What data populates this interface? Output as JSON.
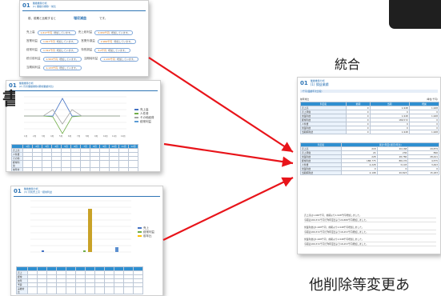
{
  "labels": {
    "merge": "統合",
    "bottom_note": "他削除等変更あ",
    "partial_glyph": "書"
  },
  "doc1": {
    "page_num": "01",
    "title_line1": "業績推移分析",
    "title_line2": "(1) 業績の推移・前比",
    "headline_prefix": "前、前期と比較すると",
    "headline_highlight": "増収減益",
    "headline_suffix": "です。",
    "rows": [
      {
        "label": "売上高",
        "v1": "1,617千円",
        "t1": "増加しています。",
        "label2": "売上総利益",
        "v2": "3,950千円",
        "t2": "増加しています。"
      },
      {
        "label": "営業利益",
        "v1": "1,617千円",
        "t1": "増加しています。",
        "label2": "営業外損益",
        "v2": "2,964千円",
        "t2": "増加しています。"
      },
      {
        "label": "経常利益",
        "v1": "1,312千円",
        "t1": "増加しています。",
        "label2": "特別損益",
        "v2": "3,2千円",
        "t2": "増加しています。"
      },
      {
        "label": "税引前利益",
        "v1": "1,504千円",
        "t1": "増加しています。",
        "label2": "当期純利益",
        "v2": "1,133千円",
        "t2": "増加しています。"
      },
      {
        "label": "当期純利益",
        "v1": "1,133千円",
        "t1": "増加しています。",
        "label2": "",
        "v2": "",
        "t2": ""
      }
    ]
  },
  "doc2": {
    "page_num": "01",
    "title_line1": "業績推移分析",
    "title_line2": "(2) 月次業績推移(期前業績対比)",
    "legend": [
      {
        "name": "売上高",
        "color": "#4472c4"
      },
      {
        "name": "人件費",
        "color": "#70ad47"
      },
      {
        "name": "その他経費",
        "color": "#a5a5a5"
      },
      {
        "name": "経常利益",
        "color": "#5b9bd5"
      }
    ],
    "months": [
      "1月",
      "2月",
      "3月",
      "4月",
      "5月",
      "6月",
      "7月",
      "8月",
      "9月",
      "10月",
      "11月",
      "12月"
    ],
    "row_labels": [
      "売上高",
      "人件費",
      "その他",
      "経常利益",
      "前年対比",
      "累計"
    ]
  },
  "doc3": {
    "page_num": "01",
    "title_line1": "業績推移分析",
    "title_line2": "(3) 月別売上高・経常利益",
    "legend": [
      {
        "name": "売上",
        "color": "#4472c4"
      },
      {
        "name": "経常利益",
        "color": "#70ad47"
      },
      {
        "name": "前年比",
        "color": "#ffc000"
      }
    ],
    "row_labels": [
      "売上",
      "経常",
      "前年",
      "予算",
      "実績対比"
    ]
  },
  "doc4": {
    "page_num": "01",
    "title_line1": "業績推移分析",
    "title_line2": "(1) 損益業績",
    "subtitle": "(千円/業績年次比較)",
    "table1_title": "前年対比",
    "table1_unit": "(単位:千円)",
    "table1_cols": [
      "科目名",
      "前期",
      "当期",
      "増減"
    ],
    "table1_rows": [
      {
        "name": "売上高",
        "a": "0",
        "b": "1,948",
        "c": "1,948"
      },
      {
        "name": "売上原価",
        "a": "0",
        "b": "0",
        "c": "0"
      },
      {
        "name": "営業利益",
        "a": "0",
        "b": "1,948",
        "c": "1,948"
      },
      {
        "name": "経常利益",
        "a": "0",
        "b": "189,572",
        "c": "0"
      },
      {
        "name": "人件費",
        "a": "0",
        "b": "0",
        "c": "0"
      },
      {
        "name": "営業利益",
        "a": "0",
        "b": "0",
        "c": "0"
      },
      {
        "name": "当期純利益",
        "a": "0",
        "b": "1,948",
        "c": "1,948"
      }
    ],
    "table2_title": "累計(年度)/累月(年比)",
    "table2_rows": [
      {
        "name": "売上高",
        "a": "218",
        "b": "20,168",
        "c": "29,879"
      },
      {
        "name": "売上原価",
        "a": "24",
        "b": "236",
        "c": "896"
      },
      {
        "name": "営業利益",
        "a": "228",
        "b": "28,786",
        "c": "28,441"
      },
      {
        "name": "経常利益",
        "a": "188,775",
        "b": "88,176",
        "c": "4,575"
      },
      {
        "name": "人件費",
        "a": "4,228",
        "b": "3,103",
        "c": "3,493"
      },
      {
        "name": "営業利益",
        "a": "0",
        "b": "0",
        "c": "0"
      },
      {
        "name": "当期純利益",
        "a": "4,198",
        "b": "20,823",
        "c": "15,183"
      }
    ],
    "notes": [
      "売上高は1,948千円、前期より1,948千円増加しました。",
      "今期は189,572千円で昨年度比より20,888千円増加しました。",
      "営業利益は1,948千円、前期より1,948千円増加しました。",
      "今期は189,572千円で昨年度比より18,453千円増加しました。",
      "営業利益は1,948千円、前期より1,948千円増加しました。",
      "今期は189,572千円で昨年度比より18,453千円増加しました。"
    ]
  }
}
